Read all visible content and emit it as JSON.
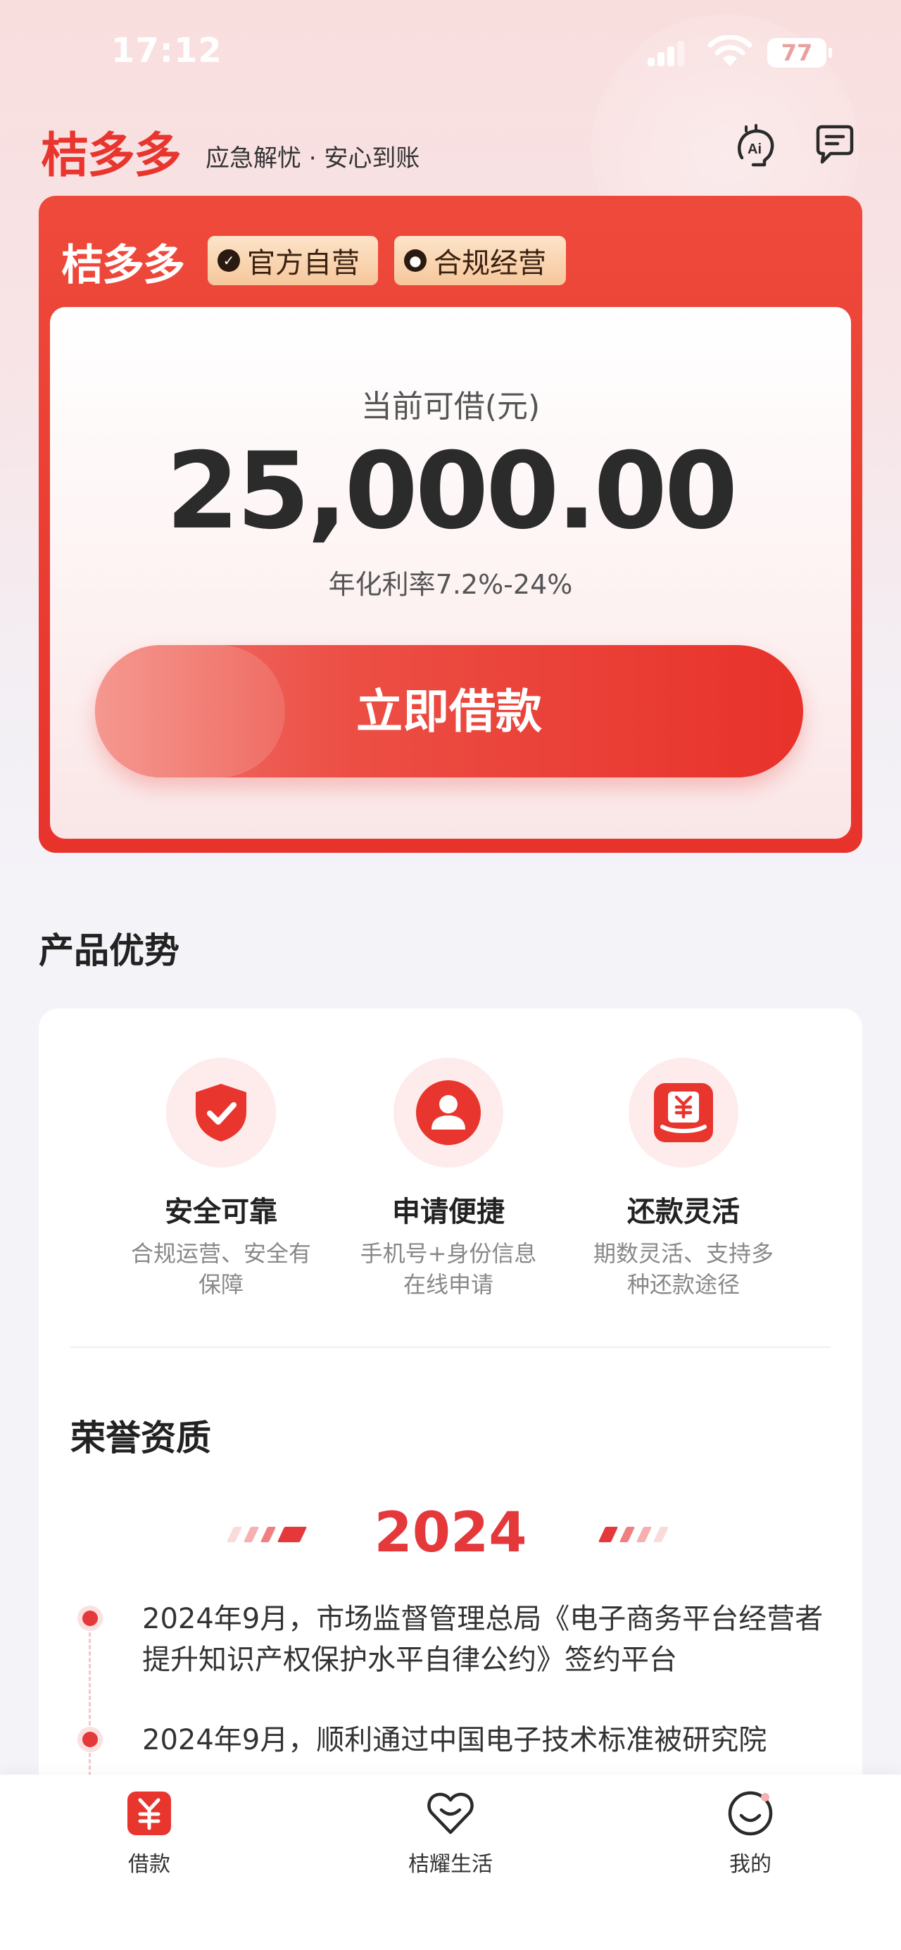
{
  "status_bar": {
    "time": "17:12",
    "battery": "77"
  },
  "header": {
    "brand": "桔多多",
    "slogan": "应急解忧 · 安心到账"
  },
  "loan_card": {
    "brand": "桔多多",
    "badges": [
      "官方自营",
      "合规经营"
    ],
    "amount_label": "当前可借(元)",
    "amount": "25,000.00",
    "rate": "年化利率7.2%-24%",
    "button_label": "立即借款"
  },
  "section_title": "产品优势",
  "features": [
    {
      "title": "安全可靠",
      "desc": "合规运营、安全有保障",
      "icon": "shield-check-icon"
    },
    {
      "title": "申请便捷",
      "desc": "手机号+身份信息在线申请",
      "icon": "user-icon"
    },
    {
      "title": "还款灵活",
      "desc": "期数灵活、支持多种还款途径",
      "icon": "yuan-receipt-icon"
    }
  ],
  "honor": {
    "title": "荣誉资质",
    "year": "2024",
    "items": [
      "2024年9月，市场监督管理总局《电子商务平台经营者提升知识产权保护水平自律公约》签约平台",
      "2024年9月，顺利通过中国电子技术标准被研究院"
    ]
  },
  "tabbar": {
    "tabs": [
      {
        "label": "借款",
        "icon": "yuan-icon",
        "active": true
      },
      {
        "label": "桔耀生活",
        "icon": "heart-shopping-icon",
        "active": false
      },
      {
        "label": "我的",
        "icon": "smile-icon",
        "active": false
      }
    ]
  },
  "colors": {
    "brand_red": "#e8352e",
    "gold_badge": "#f6c79c",
    "page_bg": "#f4f3f8"
  }
}
